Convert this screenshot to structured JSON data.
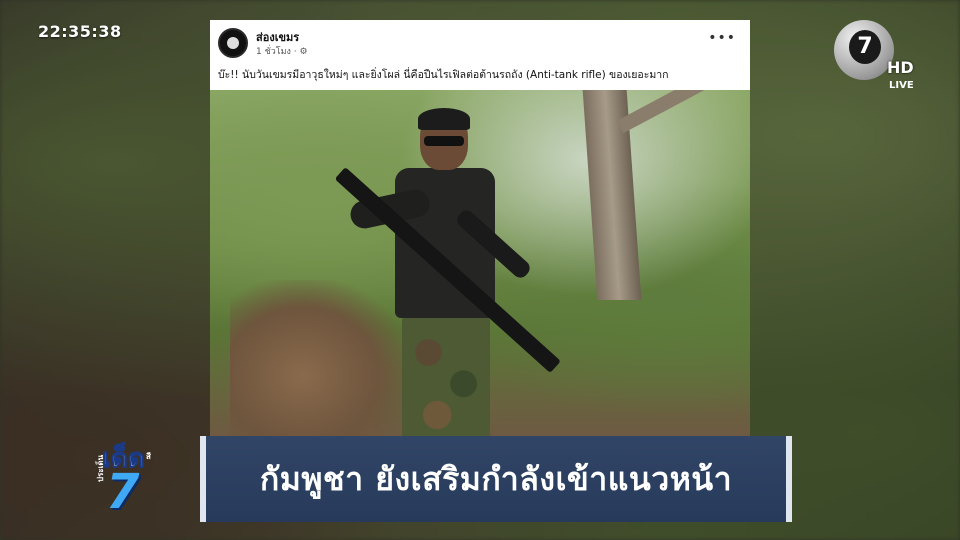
{
  "broadcast": {
    "clock": "22:35:38",
    "channel_logo_number": "7",
    "channel_hd": "HD",
    "channel_live": "LIVE"
  },
  "post": {
    "author": "ส่องเขมร",
    "time": "1 ชั่วโมง ·",
    "more": "•••",
    "caption": "บ๊ะ!! นับวันเขมรมีอาวุธใหม่ๆ และยิ่งโผล่ นี่คือปืนไรเฟิลต่อต้านรถถัง (Anti-tank rifle) ของเยอะมาก"
  },
  "headline": {
    "text": "กัมพูชา ยังเสริมกำลังเข้าแนวหน้า"
  },
  "program_logo": {
    "top": "ประเด็น",
    "main": "เด็ด",
    "number": "7",
    "side": "สี"
  }
}
